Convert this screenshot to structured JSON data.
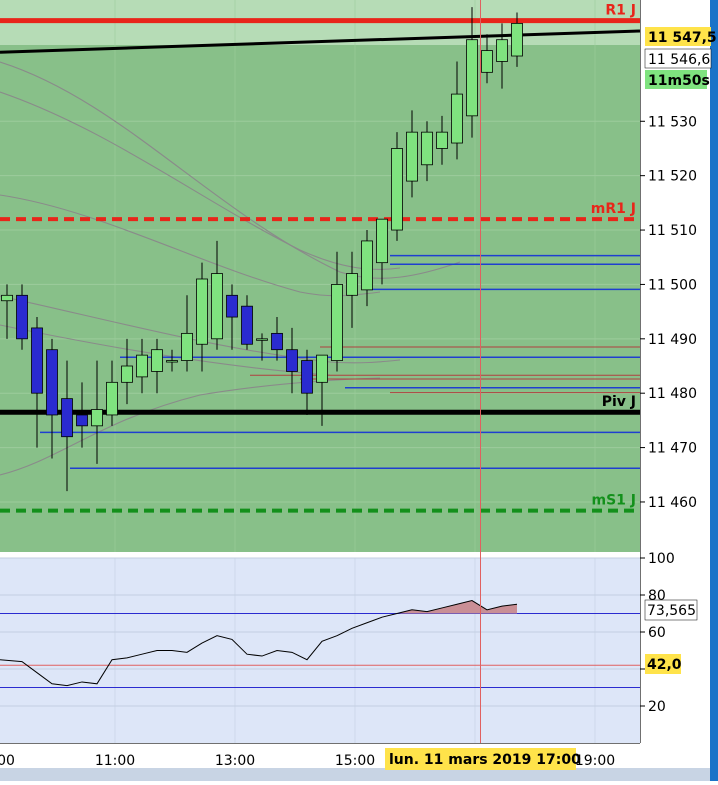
{
  "chart_data": [
    {
      "type": "candlestick",
      "title": "",
      "y_ticks": [
        11460,
        11470,
        11480,
        11490,
        11500,
        11510,
        11520,
        11530
      ],
      "y_tick_labels": [
        "11 460",
        "11 470",
        "11 480",
        "11 490",
        "11 500",
        "11 510",
        "11 520",
        "11 530"
      ],
      "ylim": [
        11450.8,
        11552.3
      ],
      "x_time_labels": [
        "11:00",
        "13:00",
        "15:00",
        "17:00",
        "19:00"
      ],
      "x_time_labels_display": [
        "00",
        "11:00",
        "13:00",
        "15:00",
        "17:00",
        "19:00"
      ],
      "candles": [
        {
          "o": 11497,
          "h": 11500,
          "l": 11490,
          "c": 11498
        },
        {
          "o": 11498,
          "h": 11500,
          "l": 11488,
          "c": 11490
        },
        {
          "o": 11492,
          "h": 11494,
          "l": 11470,
          "c": 11480
        },
        {
          "o": 11488,
          "h": 11490,
          "l": 11468,
          "c": 11476
        },
        {
          "o": 11479,
          "h": 11486,
          "l": 11462,
          "c": 11472
        },
        {
          "o": 11476,
          "h": 11482,
          "l": 11470,
          "c": 11474
        },
        {
          "o": 11474,
          "h": 11486,
          "l": 11467,
          "c": 11477
        },
        {
          "o": 11476,
          "h": 11486,
          "l": 11474,
          "c": 11482
        },
        {
          "o": 11482,
          "h": 11490,
          "l": 11478,
          "c": 11485
        },
        {
          "o": 11483,
          "h": 11490,
          "l": 11480,
          "c": 11487
        },
        {
          "o": 11484,
          "h": 11490,
          "l": 11480,
          "c": 11488
        },
        {
          "o": 11486,
          "h": 11488,
          "l": 11484,
          "c": 11486
        },
        {
          "o": 11486,
          "h": 11498,
          "l": 11484,
          "c": 11491
        },
        {
          "o": 11489,
          "h": 11504,
          "l": 11484,
          "c": 11501
        },
        {
          "o": 11490,
          "h": 11508,
          "l": 11488,
          "c": 11502
        },
        {
          "o": 11498,
          "h": 11500,
          "l": 11488,
          "c": 11494
        },
        {
          "o": 11496,
          "h": 11498,
          "l": 11488,
          "c": 11489
        },
        {
          "o": 11490,
          "h": 11491,
          "l": 11486,
          "c": 11490
        },
        {
          "o": 11491,
          "h": 11494,
          "l": 11486,
          "c": 11488
        },
        {
          "o": 11488,
          "h": 11492,
          "l": 11480,
          "c": 11484
        },
        {
          "o": 11486,
          "h": 11488,
          "l": 11476,
          "c": 11480
        },
        {
          "o": 11482,
          "h": 11487,
          "l": 11474,
          "c": 11487
        },
        {
          "o": 11486,
          "h": 11506,
          "l": 11484,
          "c": 11500
        },
        {
          "o": 11498,
          "h": 11506,
          "l": 11492,
          "c": 11502
        },
        {
          "o": 11499,
          "h": 11510,
          "l": 11496,
          "c": 11508
        },
        {
          "o": 11504,
          "h": 11512,
          "l": 11500,
          "c": 11512
        },
        {
          "o": 11510,
          "h": 11528,
          "l": 11508,
          "c": 11525
        },
        {
          "o": 11519,
          "h": 11532,
          "l": 11516,
          "c": 11528
        },
        {
          "o": 11522,
          "h": 11530,
          "l": 11519,
          "c": 11528
        },
        {
          "o": 11525,
          "h": 11531,
          "l": 11522,
          "c": 11528
        },
        {
          "o": 11526,
          "h": 11541,
          "l": 11523,
          "c": 11535
        },
        {
          "o": 11531,
          "h": 11551,
          "l": 11527,
          "c": 11545
        },
        {
          "o": 11539,
          "h": 11546,
          "l": 11537,
          "c": 11543
        },
        {
          "o": 11541,
          "h": 11548,
          "l": 11536,
          "c": 11545
        },
        {
          "o": 11542,
          "h": 11550,
          "l": 11540,
          "c": 11548
        }
      ],
      "levels": [
        {
          "label": "R1 J",
          "value": 11548.5,
          "style": "solid",
          "color": "#e8251a"
        },
        {
          "label": "mR1 J",
          "value": 11512,
          "style": "dashed",
          "color": "#e8251a"
        },
        {
          "label": "Piv J",
          "value": 11476.5,
          "style": "solid",
          "color": "#000000"
        },
        {
          "label": "mS1 J",
          "value": 11458.4,
          "style": "dashed",
          "color": "#13901b"
        }
      ],
      "trendline": {
        "from": 11542.7,
        "to": 11546.6
      },
      "support_lines": [
        11505.3,
        11503.7,
        11499.1,
        11486.6,
        11481,
        11472.8,
        11466.2
      ],
      "price_labels": {
        "last": "11 547,5",
        "trend": "11 546,6",
        "timer": "11m50s"
      },
      "cursor_date_label": "lun. 11 mars 2019 17:00",
      "colors": {
        "bg": "#88c089",
        "bull": "#7fe37f",
        "bear": "#2a2bd0",
        "panel_bg": "#dde6f8",
        "ma": "#8a8a8a"
      }
    },
    {
      "type": "line",
      "title": "",
      "ylim": [
        0,
        100
      ],
      "y_ticks": [
        20,
        40,
        60,
        80,
        100
      ],
      "y_tick_labels": [
        "20",
        "",
        "60",
        "80",
        "100"
      ],
      "levels": [
        70,
        42,
        30
      ],
      "values": [
        45,
        44,
        38,
        32,
        31,
        33,
        32,
        45,
        46,
        48,
        50,
        50,
        49,
        54,
        58,
        56,
        48,
        47,
        50,
        49,
        45,
        55,
        58,
        62,
        65,
        68,
        70,
        72,
        71,
        73,
        75,
        77,
        72,
        74,
        75
      ],
      "value_labels": {
        "last": "73,565",
        "level": "42,0"
      }
    }
  ]
}
